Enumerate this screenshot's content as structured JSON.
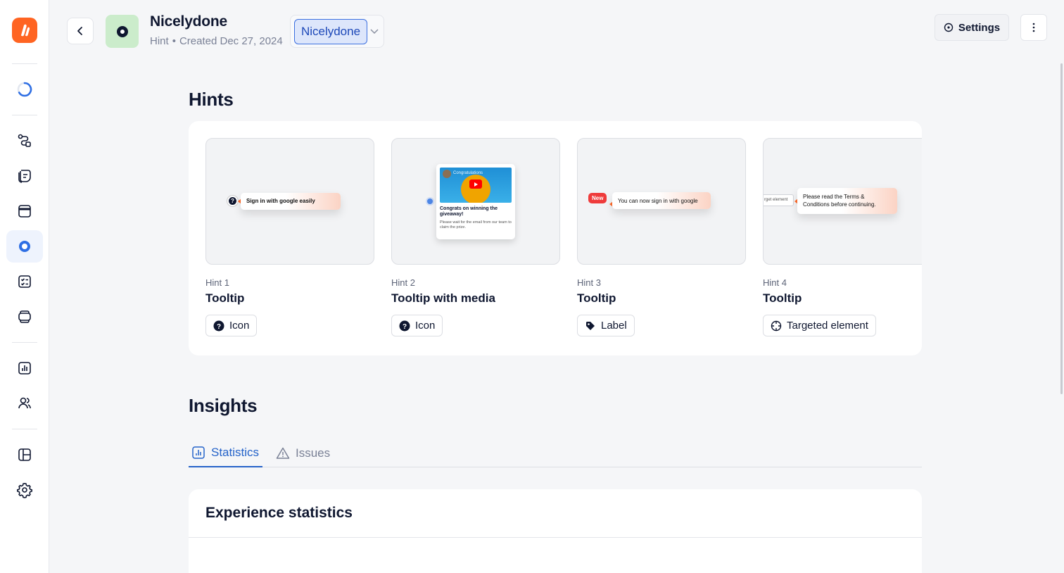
{
  "header": {
    "title": "Nicelydone",
    "type": "Hint",
    "created": "Created Dec 27, 2024",
    "environment": "Nicelydone",
    "settings_label": "Settings"
  },
  "sections": {
    "hints_title": "Hints",
    "insights_title": "Insights"
  },
  "hints": [
    {
      "number": "Hint 1",
      "type": "Tooltip",
      "trigger": "Icon",
      "preview_text": "Sign in with google easily"
    },
    {
      "number": "Hint 2",
      "type": "Tooltip with media",
      "trigger": "Icon",
      "preview_title": "Congrats on winning the giveaway!",
      "preview_body": "Please wait for the email from our team to claim the prize.",
      "video_title": "Congratulations"
    },
    {
      "number": "Hint 3",
      "type": "Tooltip",
      "trigger": "Label",
      "preview_label": "New",
      "preview_text": "You can now sign in with google"
    },
    {
      "number": "Hint 4",
      "type": "Tooltip",
      "trigger": "Targeted element",
      "preview_target": "rget element",
      "preview_text": "Please read the Terms & Conditions before continuing."
    }
  ],
  "tabs": [
    {
      "label": "Statistics",
      "active": true
    },
    {
      "label": "Issues",
      "active": false
    }
  ],
  "stats": {
    "title": "Experience statistics"
  },
  "colors": {
    "brand": "#ff6422",
    "accent": "#2563c9",
    "hint_icon_bg": "#cbeccb"
  }
}
